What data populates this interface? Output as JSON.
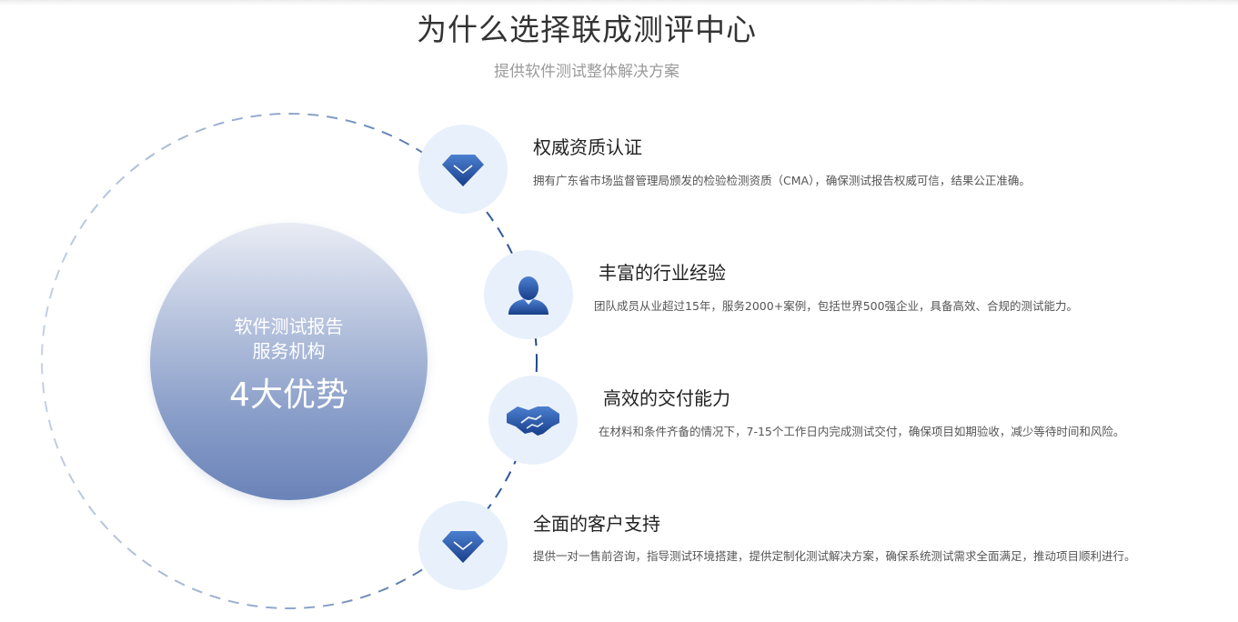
{
  "header": {
    "title": "为什么选择联成测评中心",
    "subtitle": "提供软件测试整体解决方案"
  },
  "center": {
    "line1": "软件测试报告",
    "line2": "服务机构",
    "big": "4大优势"
  },
  "colors": {
    "accent_dark": "#1a4591",
    "accent_light": "#3d6fc4",
    "icon_bg": "#e8f0fb",
    "dash": "#2c4f8c"
  },
  "features": [
    {
      "icon": "diamond-icon",
      "title": "权威资质认证",
      "desc": "拥有广东省市场监督管理局颁发的检验检测资质（CMA），确保测试报告权威可信，结果公正准确。"
    },
    {
      "icon": "person-icon",
      "title": "丰富的行业经验",
      "desc": "团队成员从业超过15年，服务2000+案例，包括世界500强企业，具备高效、合规的测试能力。"
    },
    {
      "icon": "handshake-icon",
      "title": "高效的交付能力",
      "desc": "在材料和条件齐备的情况下，7-15个工作日内完成测试交付，确保项目如期验收，减少等待时间和风险。"
    },
    {
      "icon": "diamond-icon",
      "title": "全面的客户支持",
      "desc": "提供一对一售前咨询，指导测试环境搭建，提供定制化测试解决方案，确保系统测试需求全面满足，推动项目顺利进行。"
    }
  ]
}
